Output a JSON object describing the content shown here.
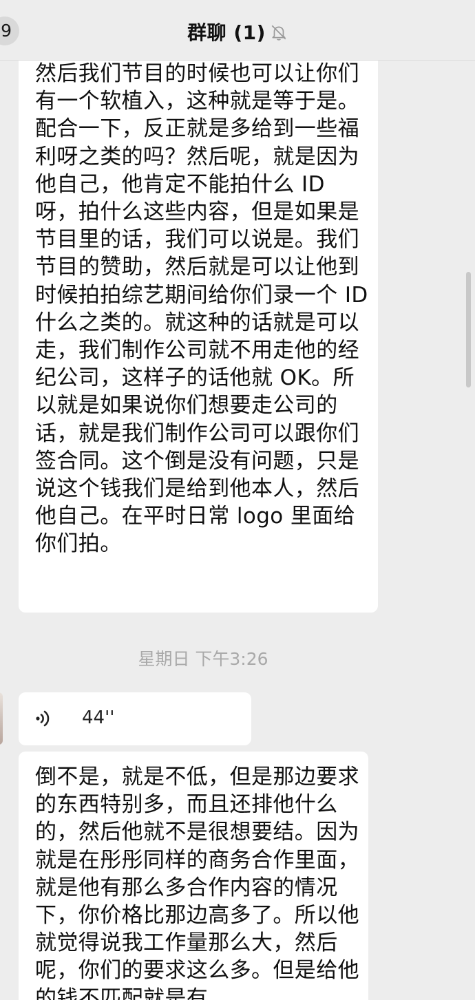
{
  "header": {
    "unread_count": "9",
    "title": "群聊 (1)",
    "mute_icon": "mute-bell-icon"
  },
  "messages": {
    "first_text": "然后我们节目的时候也可以让你们有一个软植入，这种就是等于是。配合一下，反正就是多给到一些福利呀之类的吗？然后呢，就是因为他自己，他肯定不能拍什么 ID 呀，拍什么这些内容，但是如果是节目里的话，我们可以说是。我们节目的赞助，然后就是可以让他到时候拍拍综艺期间给你们录一个 ID 什么之类的。就这种的话就是可以走，我们制作公司就不用走他的经纪公司，这样子的话他就 OK。所以就是如果说你们想要走公司的话，就是我们制作公司可以跟你们签合同。这个倒是没有问题，只是说这个钱我们是给到他本人，然后他自己。在平时日常 logo 里面给你们拍。",
    "timestamp": "星期日 下午3:26",
    "voice": {
      "icon": "voice-wave-icon",
      "duration": "44''"
    },
    "second_text": "倒不是，就是不低，但是那边要求的东西特别多，而且还排他什么的，然后他就不是很想要结。因为就是在彤彤同样的商务合作里面，就是他有那么多合作内容的情况下，你价格比那边高多了。所以他就觉得说我工作量那么大，然后呢，你们的要求这么多。但是给他的钱不匹配就是有"
  },
  "colors": {
    "background": "#ededed",
    "bubble": "#ffffff",
    "text": "#111111",
    "timestamp": "#a9a9a9"
  }
}
